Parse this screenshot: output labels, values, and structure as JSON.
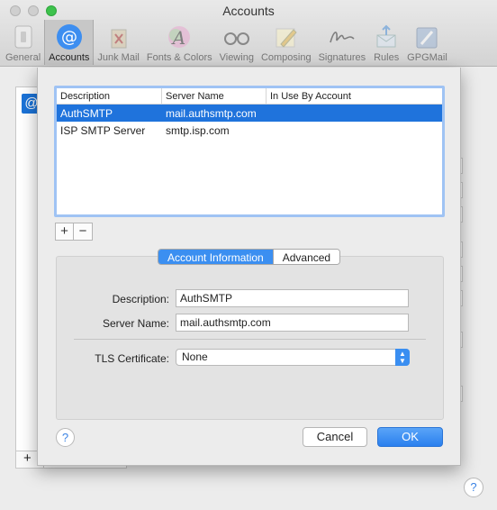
{
  "window": {
    "title": "Accounts"
  },
  "toolbar": {
    "items": [
      {
        "label": "General",
        "icon": "switch-icon",
        "active": false
      },
      {
        "label": "Accounts",
        "icon": "at-sign-icon",
        "active": true
      },
      {
        "label": "Junk Mail",
        "icon": "trash-icon",
        "active": false
      },
      {
        "label": "Fonts & Colors",
        "icon": "font-a-icon",
        "active": false
      },
      {
        "label": "Viewing",
        "icon": "glasses-icon",
        "active": false
      },
      {
        "label": "Composing",
        "icon": "pencil-icon",
        "active": false
      },
      {
        "label": "Signatures",
        "icon": "signature-icon",
        "active": false
      },
      {
        "label": "Rules",
        "icon": "envelope-arrows-icon",
        "active": false
      },
      {
        "label": "GPGMail",
        "icon": "gpg-icon",
        "active": false
      }
    ]
  },
  "table": {
    "headers": [
      "Description",
      "Server Name",
      "In Use By Account"
    ],
    "rows": [
      {
        "description": "AuthSMTP",
        "server": "mail.authsmtp.com",
        "in_use": "",
        "selected": true
      },
      {
        "description": "ISP SMTP Server",
        "server": "smtp.isp.com",
        "in_use": "",
        "selected": false
      }
    ]
  },
  "controls": {
    "add": "+",
    "remove": "−"
  },
  "tabs": {
    "account_info": "Account Information",
    "advanced": "Advanced",
    "active": "account_info"
  },
  "form": {
    "description_label": "Description:",
    "description_value": "AuthSMTP",
    "server_label": "Server Name:",
    "server_value": "mail.authsmtp.com",
    "tls_label": "TLS Certificate:",
    "tls_value": "None"
  },
  "buttons": {
    "help": "?",
    "cancel": "Cancel",
    "ok": "OK"
  },
  "background": {
    "account_icon": "@",
    "add": "+",
    "help": "?"
  },
  "colors": {
    "accent": "#1f73dc",
    "ok_button": "#3b8ff1",
    "close_light": "#3dc24c"
  }
}
